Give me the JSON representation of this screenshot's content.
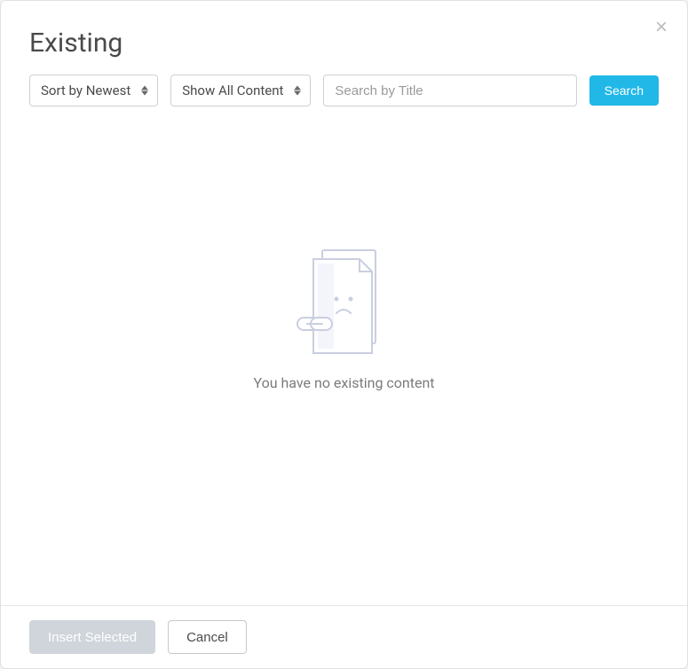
{
  "modal": {
    "title": "Existing"
  },
  "controls": {
    "sort_selected": "Sort by Newest",
    "filter_selected": "Show All Content",
    "search_placeholder": "Search by Title",
    "search_button": "Search"
  },
  "empty": {
    "message": "You have no existing content"
  },
  "footer": {
    "insert_label": "Insert Selected",
    "cancel_label": "Cancel"
  }
}
